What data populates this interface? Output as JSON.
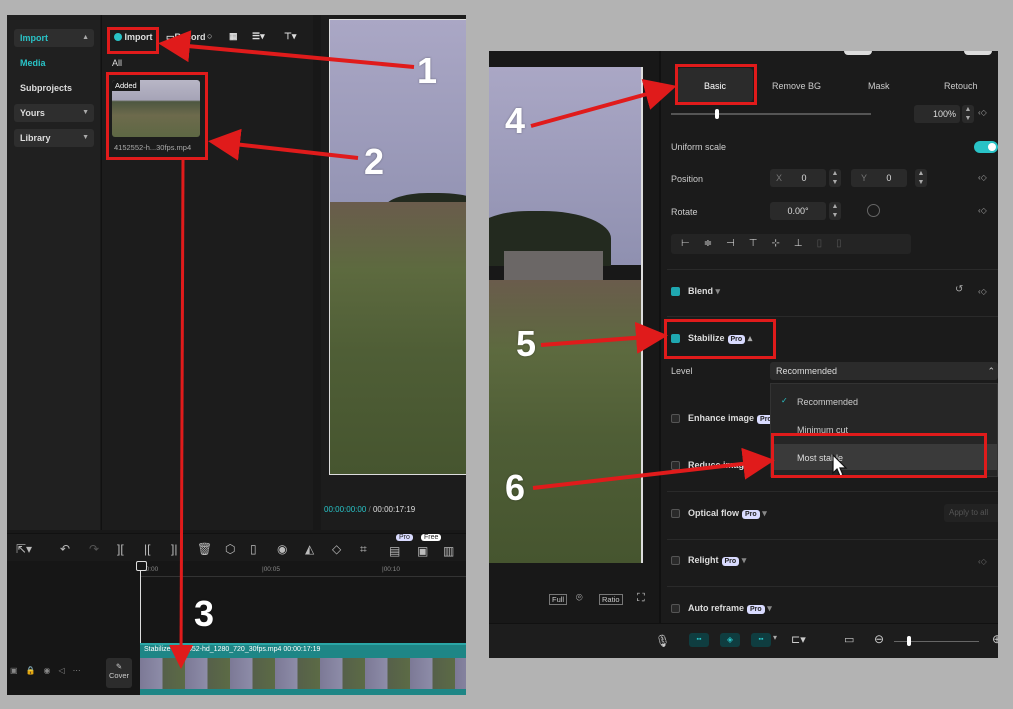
{
  "left": {
    "sidebar": [
      {
        "label": "Import",
        "active": true
      },
      {
        "label": "Media",
        "active": false
      },
      {
        "label": "Subprojects",
        "active": false
      },
      {
        "label": "Yours",
        "active": false
      },
      {
        "label": "Library",
        "active": false
      }
    ],
    "toolbar": {
      "import": "Import",
      "record": "Record"
    },
    "filter": "All",
    "media": {
      "badge": "Added",
      "filename": "4152552-h...30fps.mp4"
    },
    "player": {
      "current": "00:00:00:00",
      "sep": "/",
      "total": "00:00:17:19"
    },
    "edit_badges": {
      "pro": "Pro",
      "free": "Free"
    },
    "ruler": [
      "00:00",
      "|00:05",
      "|00:10"
    ],
    "clip": {
      "title": "Stabilize",
      "name": "4152552-hd_1280_720_30fps.mp4",
      "duration": "00:00:17:19"
    },
    "cover": "Cover"
  },
  "right": {
    "tabs": [
      "Basic",
      "Remove BG",
      "Mask",
      "Retouch"
    ],
    "scale_value": "100%",
    "uniform_scale": "Uniform scale",
    "position": {
      "label": "Position",
      "x_label": "X",
      "x": "0",
      "y_label": "Y",
      "y": "0"
    },
    "rotate": {
      "label": "Rotate",
      "value": "0.00°"
    },
    "blend": "Blend",
    "stabilize": {
      "label": "Stabilize",
      "pro": "Pro"
    },
    "level": {
      "label": "Level",
      "selected": "Recommended"
    },
    "dropdown": [
      "Recommended",
      "Minimum cut",
      "Most stable"
    ],
    "enhance": "Enhance image",
    "reduce": "Reduce image n",
    "optical": "Optical flow",
    "apply_all": "Apply to all",
    "relight": "Relight",
    "reframe": "Auto reframe",
    "pro": "Pro",
    "player_btns": [
      "Full",
      "Ratio"
    ]
  },
  "annotations": [
    "1",
    "2",
    "3",
    "4",
    "5",
    "6"
  ],
  "colors": {
    "accent": "#29c3c7",
    "annotation": "#e01b1b",
    "track": "#1e8686"
  }
}
